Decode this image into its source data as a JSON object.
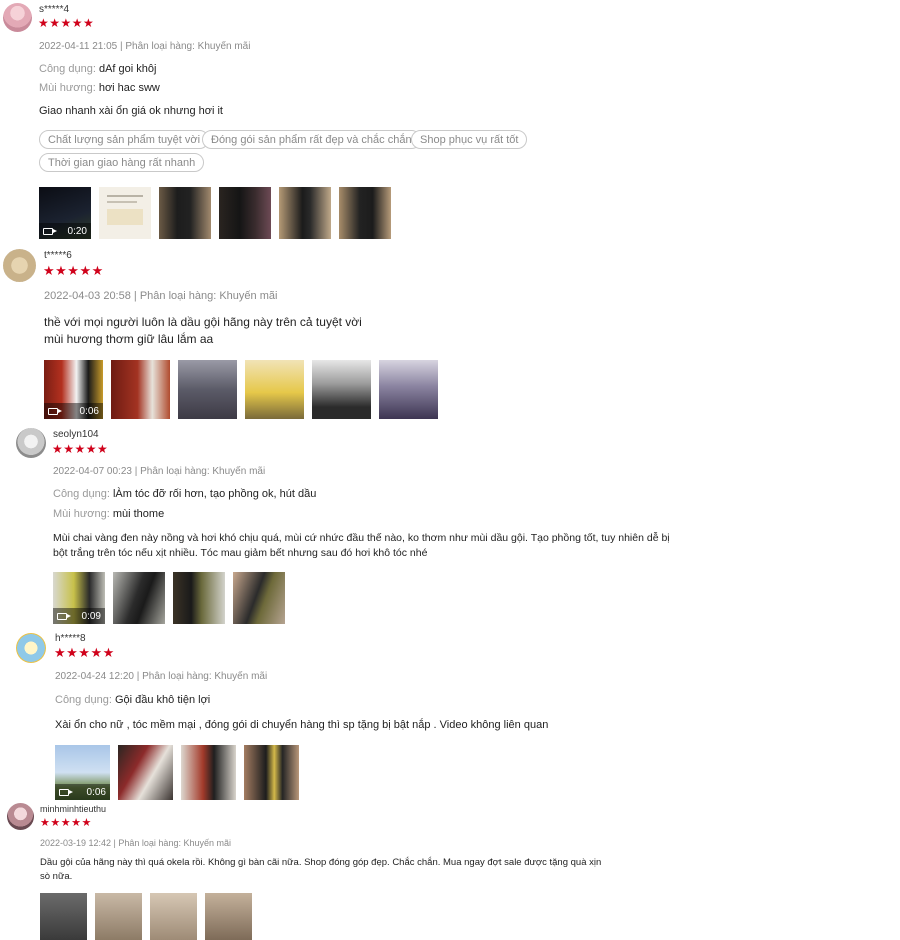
{
  "reviews": [
    {
      "username": "s*****4",
      "stars": "★★★★★",
      "meta": "2022-04-11 21:05 | Phân loại hàng: Khuyến mãi",
      "attr1_label": "Công dụng:",
      "attr1_value": "dAf goi khôj",
      "attr2_label": "Mùi hương:",
      "attr2_value": "hơi hac sww",
      "body": "Giao nhanh xài ổn giá ok nhưng hơi it",
      "tags": [
        "Chất lượng sản phẩm tuyệt vời",
        "Đóng gói sản phẩm rất đẹp và chắc chắn",
        "Shop phục vụ rất tốt",
        "Thời gian giao hàng rất nhanh"
      ],
      "video_duration": "0:20"
    },
    {
      "username": "t*****6",
      "stars": "★★★★★",
      "meta": "2022-04-03 20:58 | Phân loại hàng: Khuyến mãi",
      "body_line1": "thề với mọi người luôn là dầu gội hãng này trên cả tuyệt vời",
      "body_line2": "mùi hương thơm giữ lâu lắm aa",
      "video_duration": "0:06"
    },
    {
      "username": "seolyn104",
      "stars": "★★★★★",
      "meta": "2022-04-07 00:23 | Phân loại hàng: Khuyến mãi",
      "attr1_label": "Công dụng:",
      "attr1_value": "lÀm tóc đỡ rối hơn, tạo phồng ok, hút dầu",
      "attr2_label": "Mùi hương:",
      "attr2_value": "mùi thome",
      "body_line1": "Mùi chai vàng đen này nồng và hơi khó chịu quá, mùi cứ nhức đầu thế nào, ko thơm như mùi dầu gội. Tạo phồng tốt, tuy nhiên dễ bị",
      "body_line2": "bột trắng trên tóc nếu xịt nhiều. Tóc mau giảm bết nhưng sau đó hơi khô tóc nhé",
      "video_duration": "0:09"
    },
    {
      "username": "h*****8",
      "stars": "★★★★★",
      "meta": "2022-04-24 12:20 | Phân loại hàng: Khuyến mãi",
      "attr1_label": "Công dụng:",
      "attr1_value": "Gội đầu khô tiện lợi",
      "body": "Xài ổn cho nữ , tóc mềm mại , đóng gói di chuyển hàng thì sp tặng bị bật nắp .  Video không liên quan",
      "video_duration": "0:06"
    },
    {
      "username": "minhminhtieuthu",
      "stars": "★★★★★",
      "meta": "2022-03-19 12:42 | Phân loại hàng: Khuyến mãi",
      "body_line1": "Dầu gội của hãng này thì quá okela rồi. Không gì bàn cãi nữa. Shop đóng góp đẹp. Chắc chắn. Mua ngay đợt sale được tặng quà xịn",
      "body_line2": "sò nữa."
    }
  ],
  "colors": {
    "star": "#d0021b",
    "meta": "#8a8a8a",
    "label": "#9a9a9a",
    "tag_border": "#c9c9c9"
  },
  "icons": {
    "video": "video-camera-icon",
    "star": "star-icon"
  }
}
